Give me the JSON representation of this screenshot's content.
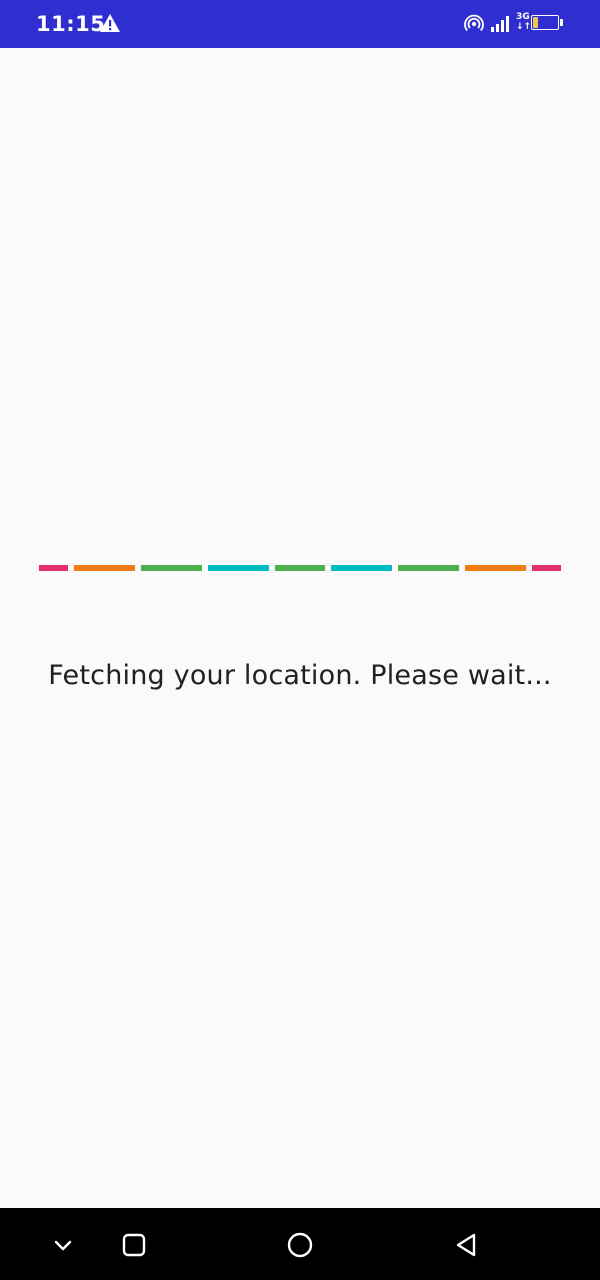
{
  "status_bar": {
    "time": "11:15",
    "network_type_top": "3G",
    "network_type_bottom": "↓↑",
    "battery_level": "19",
    "battery_fraction": 0.19,
    "background_color": "#2f2fd1",
    "icons": [
      "warning-icon",
      "hotspot-icon",
      "signal-icon",
      "battery-icon"
    ]
  },
  "loader": {
    "segments": [
      {
        "color": "#e0306e"
      },
      {
        "color": "#f07c16"
      },
      {
        "color": "#4caf50"
      },
      {
        "color": "#00bcbc"
      },
      {
        "color": "#4caf50"
      },
      {
        "color": "#00bcbc"
      },
      {
        "color": "#4caf50"
      },
      {
        "color": "#f07c16"
      },
      {
        "color": "#e0306e"
      }
    ]
  },
  "main": {
    "message": "Fetching your location. Please wait..."
  },
  "nav_bar": {
    "buttons": [
      "chevron-down-icon",
      "recents-icon",
      "home-icon",
      "back-icon"
    ]
  }
}
